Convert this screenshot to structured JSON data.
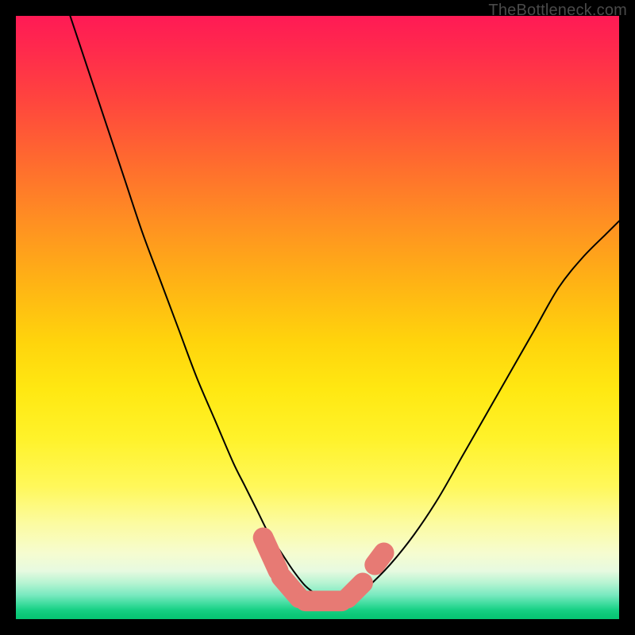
{
  "watermark": "TheBottleneck.com",
  "colors": {
    "frame": "#000000",
    "curve_stroke": "#000000",
    "marker_fill": "#e77a74",
    "gradient_top": "#ff1a55",
    "gradient_bottom": "#07c573"
  },
  "chart_data": {
    "type": "line",
    "title": "",
    "xlabel": "",
    "ylabel": "",
    "xlim": [
      0,
      100
    ],
    "ylim": [
      0,
      100
    ],
    "grid": false,
    "legend": false,
    "note": "Axes are unlabeled in the source image; x and y are expressed as 0–100 percent of the plot's inner width/height with y increasing upward. Values estimated from pixel positions against the gradient.",
    "series": [
      {
        "name": "bottleneck-curve",
        "x": [
          9,
          12,
          15,
          18,
          21,
          24,
          27,
          30,
          33,
          36,
          38,
          40,
          42,
          44,
          46,
          48,
          50,
          52,
          54,
          56,
          58,
          62,
          66,
          70,
          74,
          78,
          82,
          86,
          90,
          94,
          98,
          100
        ],
        "y": [
          100,
          91,
          82,
          73,
          64,
          56,
          48,
          40,
          33,
          26,
          22,
          18,
          14,
          11,
          8,
          5.5,
          4,
          3,
          3,
          3.5,
          5,
          9,
          14,
          20,
          27,
          34,
          41,
          48,
          55,
          60,
          64,
          66
        ]
      }
    ],
    "markers": [
      {
        "name": "left-sausage-a",
        "x1": 41,
        "y1": 13.5,
        "x2": 43.5,
        "y2": 8,
        "r": 1.7
      },
      {
        "name": "left-sausage-b",
        "x1": 44,
        "y1": 7,
        "x2": 47,
        "y2": 3.5,
        "r": 1.7
      },
      {
        "name": "bottom-sausage",
        "x1": 48,
        "y1": 3,
        "x2": 54,
        "y2": 3,
        "r": 1.7
      },
      {
        "name": "right-sausage-a",
        "x1": 55,
        "y1": 3.5,
        "x2": 57.5,
        "y2": 6,
        "r": 1.7
      },
      {
        "name": "right-sausage-b",
        "x1": 59.5,
        "y1": 9,
        "x2": 61,
        "y2": 11,
        "r": 1.7
      }
    ]
  }
}
